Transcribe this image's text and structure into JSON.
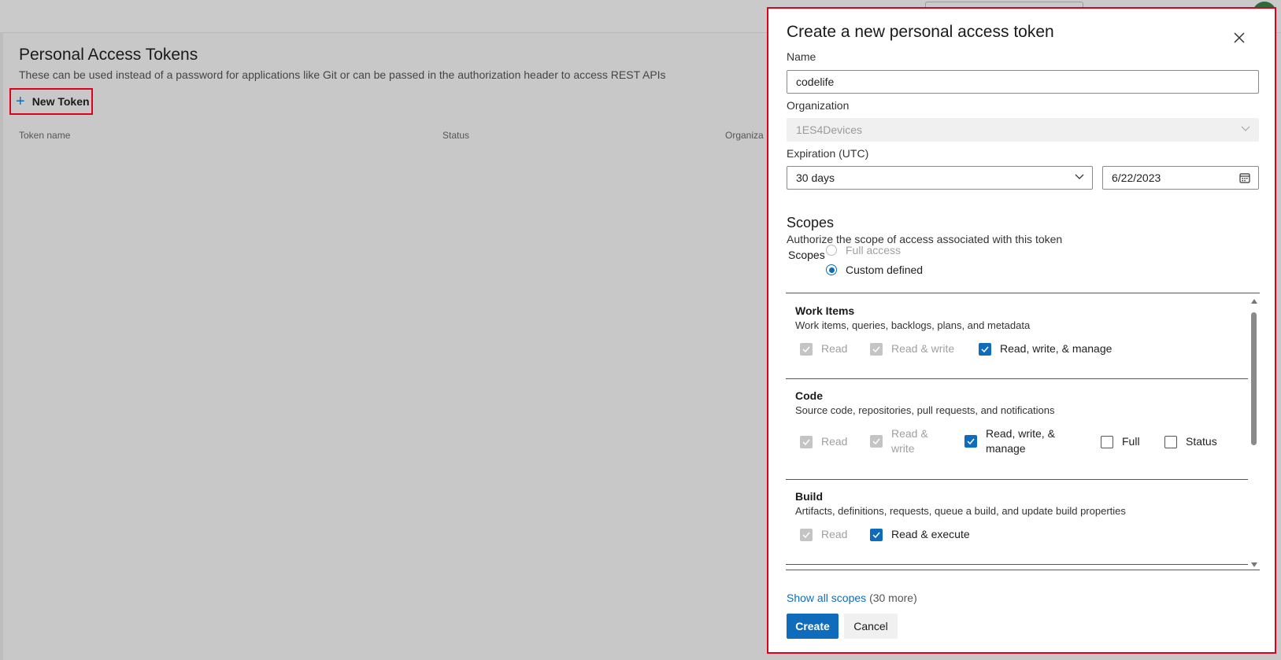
{
  "background": {
    "title": "Personal Access Tokens",
    "subtitle": "These can be used instead of a password for applications like Git or can be passed in the authorization header to access REST APIs",
    "new_token_label": "New Token",
    "columns": [
      "Token name",
      "Status",
      "Organiza"
    ]
  },
  "panel": {
    "title": "Create a new personal access token",
    "name_label": "Name",
    "name_value": "codelife",
    "org_label": "Organization",
    "org_value": "1ES4Devices",
    "expiration_label": "Expiration (UTC)",
    "expiration_value": "30 days",
    "date_value": "6/22/2023",
    "scopes_heading": "Scopes",
    "scopes_subtitle": "Authorize the scope of access associated with this token",
    "scopes_label": "Scopes",
    "radio_full": "Full access",
    "radio_custom": "Custom defined",
    "scopes": [
      {
        "name": "Work Items",
        "description": "Work items, queries, backlogs, plans, and metadata",
        "options": [
          {
            "label": "Read",
            "state": "disabled-checked"
          },
          {
            "label": "Read & write",
            "state": "disabled-checked"
          },
          {
            "label": "Read, write, & manage",
            "state": "checked"
          }
        ]
      },
      {
        "name": "Code",
        "description": "Source code, repositories, pull requests, and notifications",
        "options": [
          {
            "label": "Read",
            "state": "disabled-checked"
          },
          {
            "label": "Read & write",
            "state": "disabled-checked"
          },
          {
            "label": "Read, write, & manage",
            "state": "checked"
          },
          {
            "label": "Full",
            "state": "unchecked"
          },
          {
            "label": "Status",
            "state": "unchecked"
          }
        ]
      },
      {
        "name": "Build",
        "description": "Artifacts, definitions, requests, queue a build, and update build properties",
        "options": [
          {
            "label": "Read",
            "state": "disabled-checked"
          },
          {
            "label": "Read & execute",
            "state": "checked"
          }
        ]
      }
    ],
    "show_all_link": "Show all scopes",
    "show_all_count": "(30 more)",
    "create_label": "Create",
    "cancel_label": "Cancel"
  },
  "colors": {
    "accent": "#0f6cbd",
    "highlight_border": "#e0001b"
  }
}
